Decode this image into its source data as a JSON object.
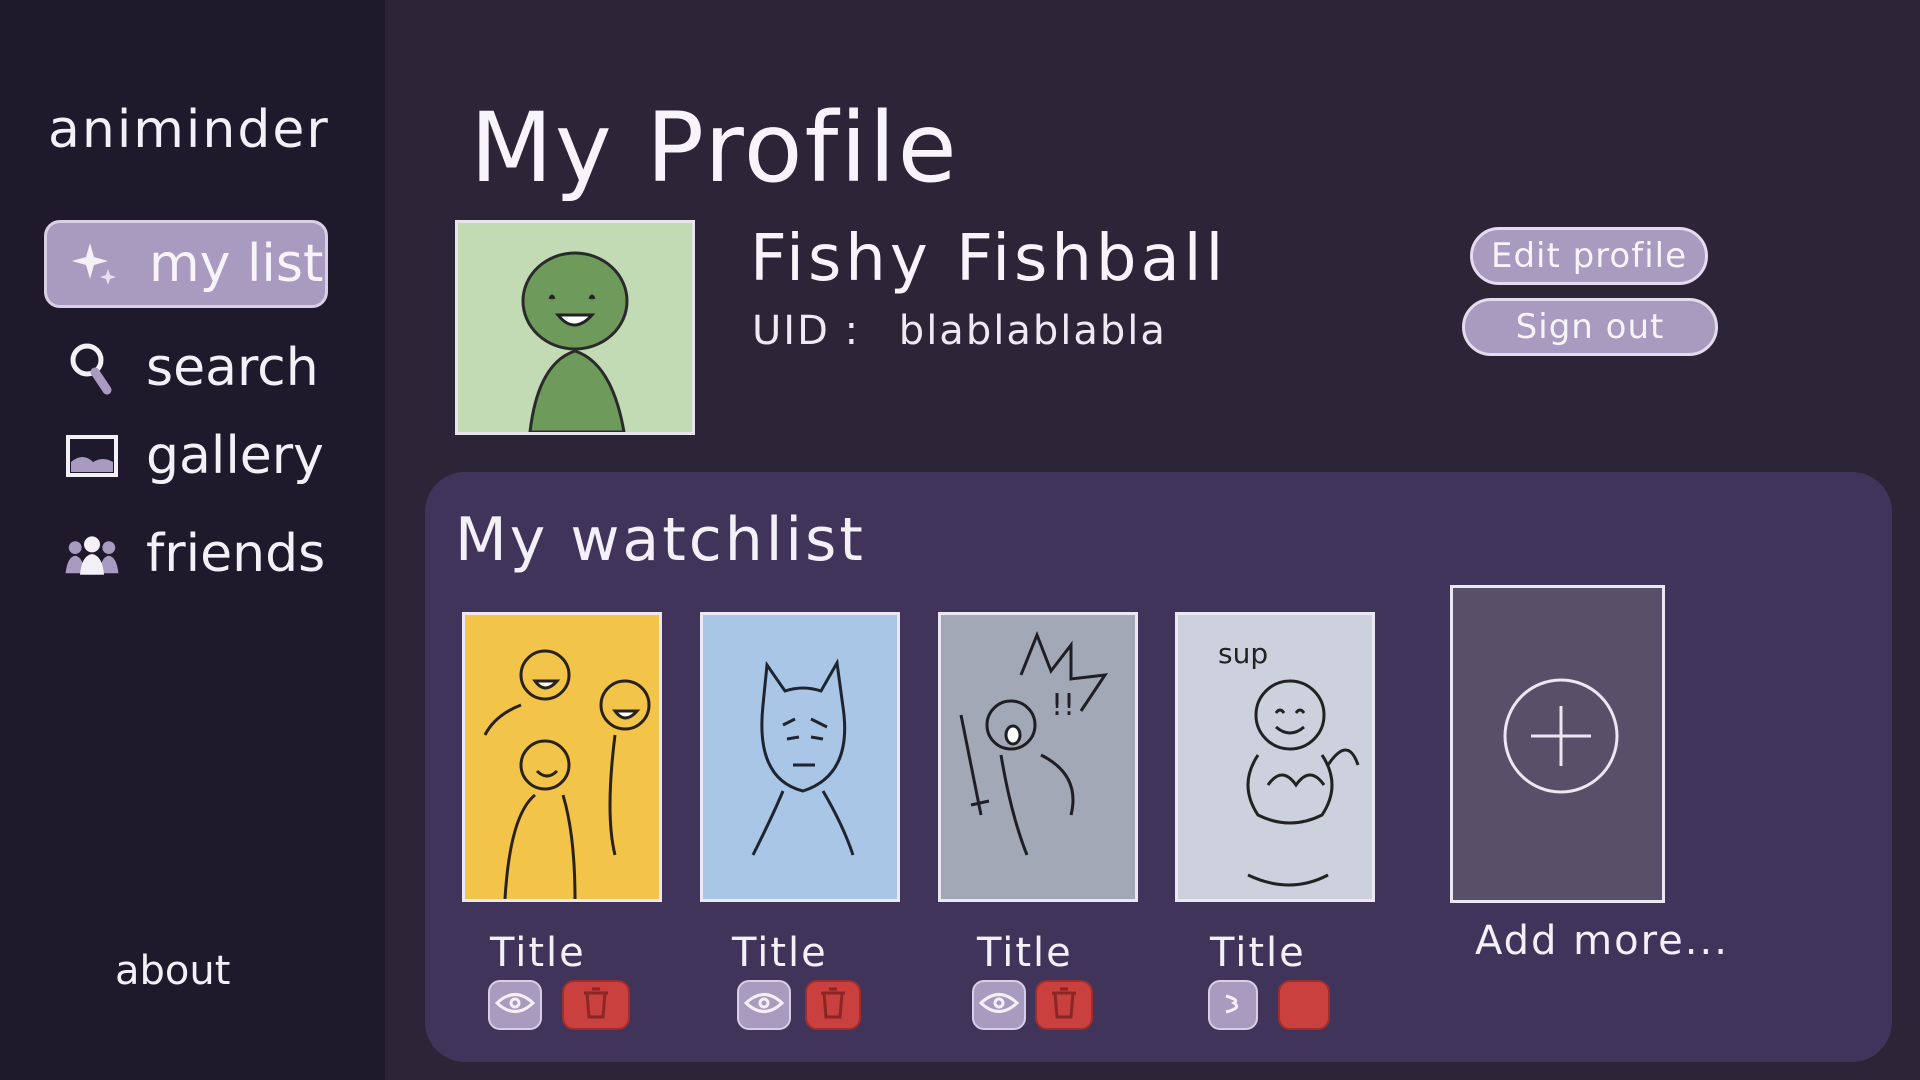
{
  "app": {
    "name": "animinder"
  },
  "sidebar": {
    "items": [
      {
        "label": "my list",
        "icon": "sparkle-icon",
        "active": true
      },
      {
        "label": "search",
        "icon": "magnifier-icon",
        "active": false
      },
      {
        "label": "gallery",
        "icon": "image-icon",
        "active": false
      },
      {
        "label": "friends",
        "icon": "people-icon",
        "active": false
      }
    ],
    "about_label": "about"
  },
  "profile": {
    "title": "My Profile",
    "name": "Fishy Fishball",
    "uid_label": "UID :",
    "uid_value": "blablablabla",
    "edit_label": "Edit profile",
    "signout_label": "Sign out"
  },
  "watchlist": {
    "title": "My watchlist",
    "items": [
      {
        "title": "Title",
        "color": "#f2c54a"
      },
      {
        "title": "Title",
        "color": "#a9c6e6"
      },
      {
        "title": "Title",
        "color": "#a3a8b6"
      },
      {
        "title": "Title",
        "color": "#cdd1de",
        "caption": "sup"
      }
    ],
    "add_label": "Add more..."
  },
  "colors": {
    "background": "#2c2538",
    "sidebar": "#1e1a2c",
    "accent": "#a99abf",
    "panel": "#40345a",
    "delete": "#c9403e"
  }
}
